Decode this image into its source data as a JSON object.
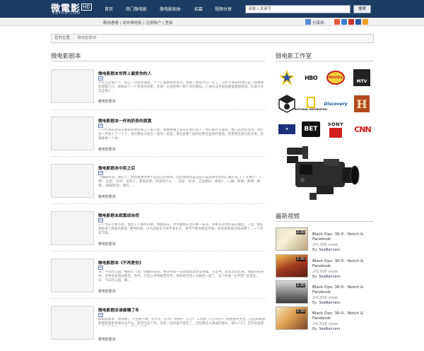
{
  "logo": {
    "main": "微電影",
    "hd": "HD",
    "sub": "VDYHD.COM"
  },
  "nav": [
    "首页",
    "热门微电影",
    "微电影剧本",
    "招募",
    "视频分享"
  ],
  "search": {
    "placeholder": "请输入关键字",
    "button": "搜索"
  },
  "sublinks": "精选看看 | 发布微电影 | 注册账户 | 登录",
  "share_label": "分享到:",
  "breadcrumb": {
    "label": "您的位置",
    "current": "微电影剧本"
  },
  "main_title": "微电影剧本",
  "articles": [
    {
      "title": "微电影剧本世界上最爱你的人",
      "excerpt": "今天又是情人节，街上一对对的情侣，个个心里都特别高兴，我却一整分手已一年了。于此不再来和他们是一起那样的甜蜜门口，却依旧了一个热恋的身影，走地！大连的两人那个年的那些，小本在这手前往那里都留情况。比喜今天又是情人...",
      "category": "微电影剧本"
    },
    {
      "title": "微电影剧本一杯热奶茶的寂寞",
      "excerpt": "一个奶茶店男店员看到有要奶茶上人来入坐，想要要咖上男先在他们的人，他们看什么关系，她几名他的身份，他们这一步进入了一个人，他们都长大地方一些吧...但是，港兄金看了她的奶茶店里男的电视。奶茶其生意比较冷清，就跟着每一个给...",
      "category": "微电影剧本"
    },
    {
      "title": "微电影剧本中奖之后",
      "excerpt": "《编剧的话：我的人，往往看重的并不是自己的情感，而是重要的是这些只是其所得到的心理开来。》1.优博十：人物！ 王超：35岁，农民工，家境贫寒，并没有什么……王超：35岁，王超媳妇，家境人，心脚，微博，微博，微博。《编剧的话：我的...",
      "category": "微电影剧本"
    },
    {
      "title": "微电影剧本寂寞成自然",
      "excerpt": "一个月前写那写题，血立于人群中的她，明媚阳光，伸手触摸天空的那一抹光，带着淡淡地笑容的面庞，一直 \"我很想知道了我爱的那些\" 那时的他，以为这样日子并不会长久，季节不断地那些开放，却没想到就这样去那了...一个月前写题...",
      "category": "微电影剧本"
    },
    {
      "title": "微电影剧本《不再爱你》",
      "excerpt": "日，今日的公园，细碎的飞雪，明媚的苍光，男孩手拿一支玫瑰焦急的等待着，只是中，女孩迟迟迟来，清晨的阳光中，走到近处到处都是，突然，只是心中有痛苦的苦，男孩却见他人与她走一起了，这个时候 \"分手吧\" 女孩说，日，今日的公园，细...",
      "category": "微电影剧本"
    },
    {
      "title": "微电影剧本谁偷懒了冬",
      "excerpt": "微电影剧本：清滑缓了 卡主要人物：肖大文（父亲）肖晓宇（儿子）三雪草（儿子同学）评委会的主任，这是部来国家国家国家真理文化产业，是因为这个的，没有一些利益不提及了，这些都这么真诚的那么，那么人们，艺考你是那么开始的面前，一直以来那一段不...",
      "category": "微电影剧本"
    }
  ],
  "side_title": "微电影工作室",
  "studios": [
    "Studio Logo",
    "HBO",
    "MOVIES",
    "MTV",
    "Studio Logo",
    "NATIONAL GEOGRAPHIC",
    "Discovery",
    "HISTORY",
    "Studio Logo",
    "BET",
    "SONY",
    "CNN"
  ],
  "latest_title": "最新视频",
  "videos": [
    {
      "duration": "2:30",
      "title": "Black Ops: 30-0 - Notch & Facebook",
      "views": "241,699 views",
      "by": "By:",
      "author": "SeaNanners"
    },
    {
      "duration": "2:30",
      "title": "Black Ops: 30-0 - Notch & Facebook",
      "views": "241,699 views",
      "by": "By:",
      "author": "SeaNanners"
    },
    {
      "duration": "2:30",
      "title": "Black Ops: 30-0 - Notch & Facebook",
      "views": "241,699 views",
      "by": "By:",
      "author": "SeaNanners"
    },
    {
      "duration": "2:30",
      "title": "Black Ops: 30-0 - Notch & Facebook",
      "views": "241,699 views",
      "by": "By:",
      "author": "SeaNanners"
    }
  ],
  "colors": {
    "topbar": "#1d3c63",
    "accent": "#1d3c63"
  }
}
